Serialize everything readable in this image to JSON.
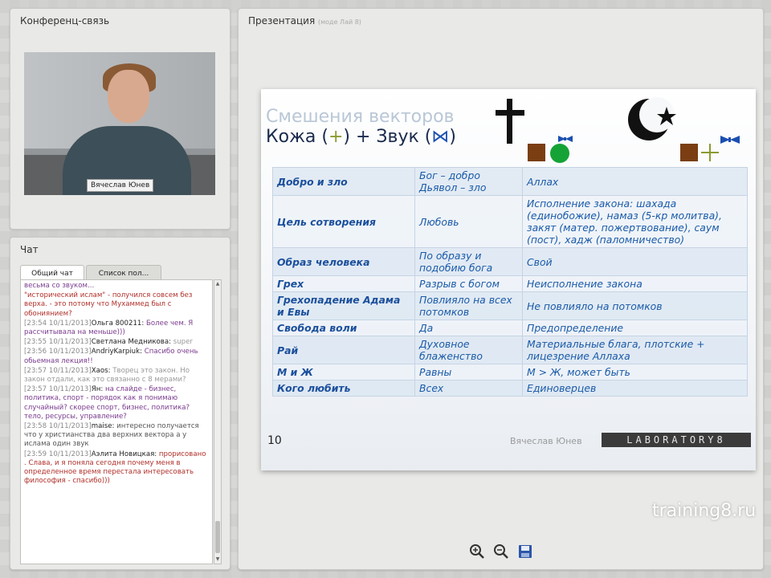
{
  "conference": {
    "title": "Конференц-связь",
    "speaker_caption": "Вячеслав Юнев"
  },
  "chat": {
    "title": "Чат",
    "tabs": [
      {
        "label": "Общий чат"
      },
      {
        "label": "Список пол..."
      }
    ],
    "messages": [
      {
        "time": "",
        "nick": "",
        "text": "весьма со звуком...",
        "style": "txt"
      },
      {
        "time": "",
        "nick": "",
        "text": "\"исторический ислам\" - получился совсем без верха. - это потому что Мухаммед был с обониянием?",
        "style": "txt red"
      },
      {
        "time": "[23:54 10/11/2013]",
        "nick": "Ольга 800211:",
        "text": "Более чем. Я рассчитывала на меньше)))",
        "style": "txt"
      },
      {
        "time": "[23:55 10/11/2013]",
        "nick": "Светлана Медникова:",
        "text": "super",
        "style": "txt gray"
      },
      {
        "time": "[23:56 10/11/2013]",
        "nick": "AndriyKarpiuk:",
        "text": "Спасибо очень обьемная лекция!!",
        "style": "txt"
      },
      {
        "time": "[23:57 10/11/2013]",
        "nick": "Xaos:",
        "text": "Творец это закон. Но закон отдали, как это связанно с 8 мерами?",
        "style": "txt gray"
      },
      {
        "time": "[23:57 10/11/2013]",
        "nick": "Ян:",
        "text": "на слайде - бизнес, политика, спорт - порядок как я понимаю случайный? скорее спорт, бизнес, политика? тело, ресурсы, управление?",
        "style": "txt"
      },
      {
        "time": "[23:58 10/11/2013]",
        "nick": "maise:",
        "text": "интересно получается что у христианства два верхних вектора а у ислама один звук",
        "style": "txt dark"
      },
      {
        "time": "[23:59 10/11/2013]",
        "nick": "Аэлита Новицкая:",
        "text": "прорисовано . Слава, и я поняла сегодня почему меня в определенное время перестала интересовать философия - спасибо)))",
        "style": "txt red"
      }
    ]
  },
  "presentation": {
    "title": "Презентация",
    "subtitle": "(моде Лай 8)",
    "slide": {
      "title_line1": "Смешения векторов",
      "title_line2_a": "Кожа (",
      "title_line2_skin": "+",
      "title_line2_b": ") + Звук (",
      "title_line2_sound": "⋈",
      "title_line2_c": ")",
      "rows": [
        {
          "key": "Добро и зло",
          "mid": "Бог – добро Дьявол – зло",
          "right": "Аллах"
        },
        {
          "key": "Цель сотворения",
          "mid": "Любовь",
          "right": "Исполнение закона: шахада (единобожие), намаз (5-кр молитва), закят (матер. пожертвование), саум (пост), хадж (паломничество)"
        },
        {
          "key": "Образ человека",
          "mid": "По образу и подобию бога",
          "right": "Свой"
        },
        {
          "key": "Грех",
          "mid": "Разрыв с богом",
          "right": "Неисполнение закона"
        },
        {
          "key": "Грехопадение Адама и Евы",
          "mid": "Повлияло на всех потомков",
          "right": "Не повлияло на потомков"
        },
        {
          "key": "Свобода воли",
          "mid": "Да",
          "right": "Предопределение"
        },
        {
          "key": "Рай",
          "mid": "Духовное блаженство",
          "right": "Материальные блага, плотские + лицезрение Аллаха"
        },
        {
          "key": "М и Ж",
          "mid": "Равны",
          "right": "М > Ж, может быть"
        },
        {
          "key": "Кого любить",
          "mid": "Всех",
          "right": "Единоверцев"
        }
      ],
      "page_number": "10",
      "author": "Вячеслав Юнев",
      "brand": "LABORATORY8"
    },
    "tools": {
      "zoom_in": "zoom-in-icon",
      "zoom_out": "zoom-out-icon",
      "save": "save-icon"
    }
  },
  "watermark": "training8.ru",
  "colors": {
    "accent_blue": "#1a5aa8",
    "skin_green": "#8c9a2f",
    "sound_blue": "#1b4fb0"
  }
}
